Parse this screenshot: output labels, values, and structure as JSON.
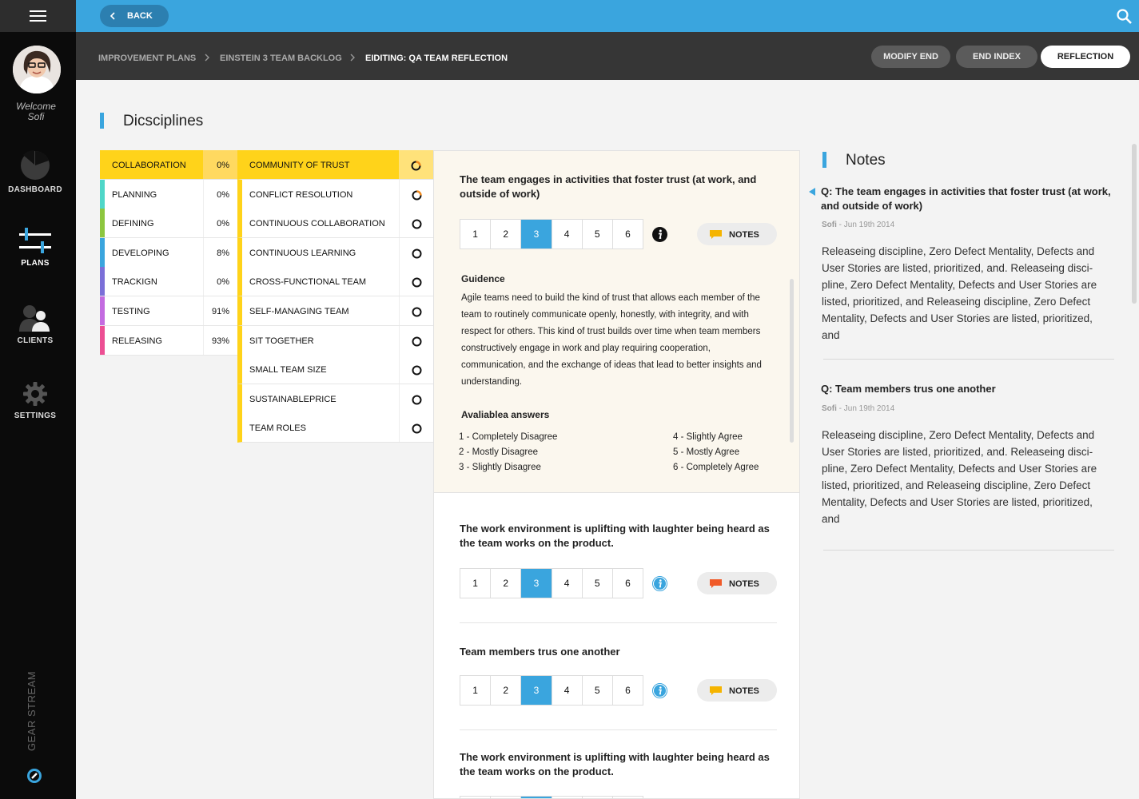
{
  "sidebar": {
    "welcome_line1": "Welcome",
    "welcome_user": "Sofi",
    "nav": [
      {
        "label": "DASHBOARD",
        "icon": "dashboard-pie-icon"
      },
      {
        "label": "PLANS",
        "icon": "sliders-icon",
        "active": true
      },
      {
        "label": "CLIENTS",
        "icon": "users-icon"
      },
      {
        "label": "SETTINGS",
        "icon": "gear-icon"
      }
    ],
    "brand": "GEAR STREAM"
  },
  "topbar": {
    "back_label": "BACK"
  },
  "breadcrumb": {
    "items": [
      "IMPROVEMENT PLANS",
      "EINSTEIN 3 TEAM BACKLOG",
      "EIDITING: QA TEAM REFLECTION"
    ]
  },
  "actions": {
    "modify_end": "MODIFY END",
    "end_index": "END INDEX",
    "reflection": "REFLECTION"
  },
  "page_title": "Dicsciplines",
  "disciplines": [
    {
      "name": "COLLABORATION",
      "pct": "0%",
      "color": "#ffd31a",
      "selected": true
    },
    {
      "name": "PLANNING",
      "pct": "0%",
      "color": "#4fd6c8"
    },
    {
      "name": "DEFINING",
      "pct": "0%",
      "color": "#8dc63f"
    },
    {
      "name": "DEVELOPING",
      "pct": "8%",
      "color": "#3aa5de"
    },
    {
      "name": "TRACKIGN",
      "pct": "0%",
      "color": "#7b6fd8"
    },
    {
      "name": "TESTING",
      "pct": "91%",
      "color": "#c36be0"
    },
    {
      "name": "RELEASING",
      "pct": "93%",
      "color": "#ec4f93"
    }
  ],
  "practices": [
    {
      "name": "COMMUNITY OF TRUST",
      "status": "partial",
      "selected": true
    },
    {
      "name": "CONFLICT RESOLUTION",
      "status": "partial"
    },
    {
      "name": "CONTINUOUS COLLABORATION",
      "status": "empty"
    },
    {
      "name": "CONTINUOUS LEARNING",
      "status": "empty"
    },
    {
      "name": "CROSS-FUNCTIONAL TEAM",
      "status": "empty"
    },
    {
      "name": "SELF-MANAGING TEAM",
      "status": "empty"
    },
    {
      "name": "SIT TOGETHER",
      "status": "empty"
    },
    {
      "name": "SMALL TEAM SIZE",
      "status": "empty"
    },
    {
      "name": "SUSTAINABLEPRICE",
      "status": "empty"
    },
    {
      "name": "TEAM ROLES",
      "status": "empty"
    }
  ],
  "questions": [
    {
      "text": "The team engages in activities that foster trust (at work, and outside of work)",
      "selected": 3,
      "info_style": "dark",
      "notes_color": "#f5b400"
    },
    {
      "text": "The work environment is uplifting with laughter being heard as the team works on the product.",
      "selected": 3,
      "info_style": "blue",
      "notes_color": "#f05a28"
    },
    {
      "text": "Team members trus one another",
      "selected": 3,
      "info_style": "blue",
      "notes_color": "#f5b400"
    },
    {
      "text": "The work environment is uplifting with laughter being heard as the team works on the product.",
      "selected": 3,
      "info_style": "blue",
      "notes_color": "#f5b400"
    }
  ],
  "scale_options": [
    "1",
    "2",
    "3",
    "4",
    "5",
    "6"
  ],
  "notes_label": "NOTES",
  "guidance": {
    "heading": "Guidence",
    "text": "Agile teams need to build the kind of trust that allows each member of the team to routinely communicate openly, honestly, with integrity, and with respect for others. This kind of trust builds over time when team members constructively engage in work and play requiring cooperation, communication, and the exchange of ideas that lead to better insights and understanding."
  },
  "answers": {
    "heading": "Avaliablea answers",
    "items": [
      "1 - Completely Disagree",
      "2 - Mostly Disagree",
      "3 - Slightly Disagree",
      "4 - Slightly Agree",
      "5 - Mostly Agree",
      "6 - Completely Agree"
    ]
  },
  "notes": {
    "title": "Notes",
    "entries": [
      {
        "question": "Q: The team engages in activities that foster trust (at work, and outside of work)",
        "author": "Sofi",
        "date": "- Jun 19th 2014",
        "body": "Releaseing discipline, Zero Defect Mentality, Defects and User Stories are listed, prioritized, and. Releaseing disci-pline, Zero Defect Mentality, Defects and User Stories are listed, prioritized, and Releaseing discipline, Zero Defect Mentality, Defects and User Stories are listed, prioritized, and"
      },
      {
        "question": "Q: Team members trus one another",
        "author": "Sofi",
        "date": "- Jun 19th 2014",
        "body": "Releaseing discipline, Zero Defect Mentality, Defects and User Stories are listed, prioritized, and. Releaseing disci-pline, Zero Defect Mentality, Defects and User Stories are listed, prioritized, and Releaseing discipline, Zero Defect Mentality, Defects and User Stories are listed, prioritized, and"
      }
    ]
  },
  "colors": {
    "accent": "#3aa5de",
    "highlight": "#ffd31a",
    "sidebar": "#0b0b0b",
    "subbar": "#363636"
  }
}
